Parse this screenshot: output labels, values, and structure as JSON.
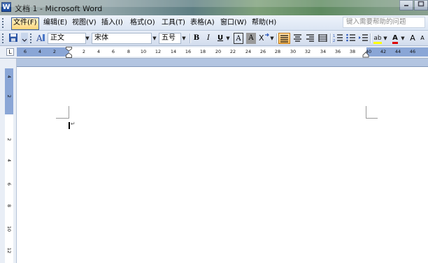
{
  "window": {
    "title": "文档 1 - Microsoft Word",
    "app_icon": "W"
  },
  "window_controls": {
    "minimize_icon": "minimize-icon",
    "maximize_icon": "maximize-icon"
  },
  "menubar": {
    "items": [
      "文件(F)",
      "编辑(E)",
      "视图(V)",
      "插入(I)",
      "格式(O)",
      "工具(T)",
      "表格(A)",
      "窗口(W)",
      "帮助(H)"
    ],
    "active_item": "文件(F)",
    "help_search_placeholder": "键入需要帮助的问题"
  },
  "toolbar": {
    "style_value": "正文",
    "font_value": "宋体",
    "size_value": "五号",
    "bold": "B",
    "italic": "I",
    "underline": "U",
    "border_char": "A",
    "shading_char": "A",
    "highlight_label": "ab",
    "font_color_label": "A",
    "grow_font": "A",
    "shrink_font": "A",
    "colors": {
      "highlight": "#ffff00",
      "font_color": "#e00000",
      "active_button": "#ffbd55"
    }
  },
  "ruler": {
    "corner_symbol": "L",
    "h_numbers": [
      "6",
      "4",
      "2",
      "2",
      "4",
      "6",
      "8",
      "10",
      "12",
      "14",
      "16",
      "18",
      "20",
      "22",
      "24",
      "26",
      "28",
      "30",
      "32",
      "34",
      "36",
      "38",
      "40",
      "42",
      "44",
      "46"
    ],
    "v_numbers": [
      "4",
      "2",
      "2",
      "4",
      "6",
      "8",
      "10",
      "12"
    ]
  },
  "document": {
    "paragraph_mark": "↵"
  }
}
